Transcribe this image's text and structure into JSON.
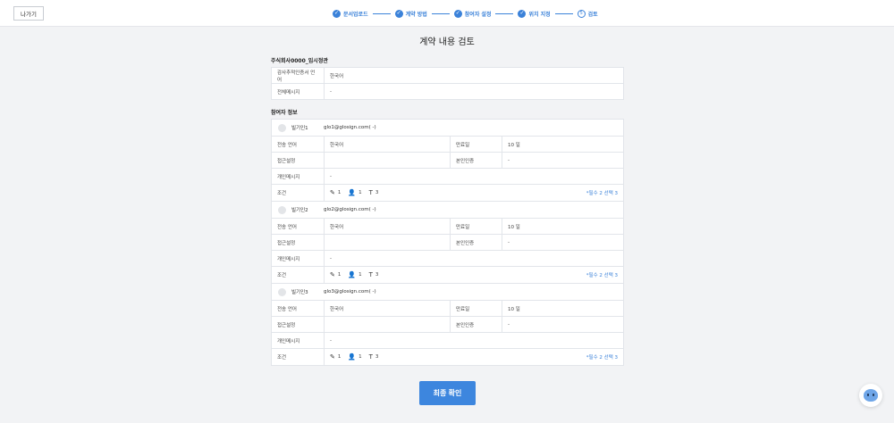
{
  "header": {
    "back_label": "나가기",
    "steps": [
      {
        "label": "문서업로드",
        "icon": "check-icon",
        "glyph": "✓"
      },
      {
        "label": "계약 방법",
        "icon": "check-icon",
        "glyph": "✓"
      },
      {
        "label": "참여자 설정",
        "icon": "check-icon",
        "glyph": "✓"
      },
      {
        "label": "위치 지정",
        "icon": "check-icon",
        "glyph": "✓"
      },
      {
        "label": "검토",
        "icon": "step-number-icon",
        "glyph": "5"
      }
    ]
  },
  "page_title": "계약 내용 검토",
  "document": {
    "title": "주식회사0000_임시정관",
    "rows": [
      {
        "label": "감사추적인증서 언어",
        "value": "한국어"
      },
      {
        "label": "전체메시지",
        "value": "-"
      }
    ]
  },
  "participants_title": "참여자 정보",
  "participants": [
    {
      "name": "빌기인1",
      "email": "glo1@glosign.com( -)",
      "send_lang_label": "전송 언어",
      "send_lang": "한국어",
      "expiry_label": "만료일",
      "expiry": "10 일",
      "access_label": "접근설정",
      "access": "",
      "auth_label": "본인인증",
      "auth": "-",
      "message_label": "개인메시지",
      "message": "-",
      "condition_label": "조건",
      "sign_count": "1",
      "person_count": "1",
      "text_count": "3",
      "required": "*필수 2  선택 3"
    },
    {
      "name": "빌기인2",
      "email": "glo2@glosign.com( -)",
      "send_lang_label": "전송 언어",
      "send_lang": "한국어",
      "expiry_label": "만료일",
      "expiry": "10 일",
      "access_label": "접근설정",
      "access": "",
      "auth_label": "본인인증",
      "auth": "-",
      "message_label": "개인메시지",
      "message": "-",
      "condition_label": "조건",
      "sign_count": "1",
      "person_count": "1",
      "text_count": "3",
      "required": "*필수 2  선택 3"
    },
    {
      "name": "빌기인3",
      "email": "glo3@glosign.com( -)",
      "send_lang_label": "전송 언어",
      "send_lang": "한국어",
      "expiry_label": "만료일",
      "expiry": "10 일",
      "access_label": "접근설정",
      "access": "",
      "auth_label": "본인인증",
      "auth": "-",
      "message_label": "개인메시지",
      "message": "-",
      "condition_label": "조건",
      "sign_count": "1",
      "person_count": "1",
      "text_count": "3",
      "required": "*필수 2  선택 3"
    }
  ],
  "confirm_label": "최종 확인",
  "colors": {
    "accent": "#3b82d9",
    "button": "#3d86de",
    "background": "#f2f3f5"
  }
}
